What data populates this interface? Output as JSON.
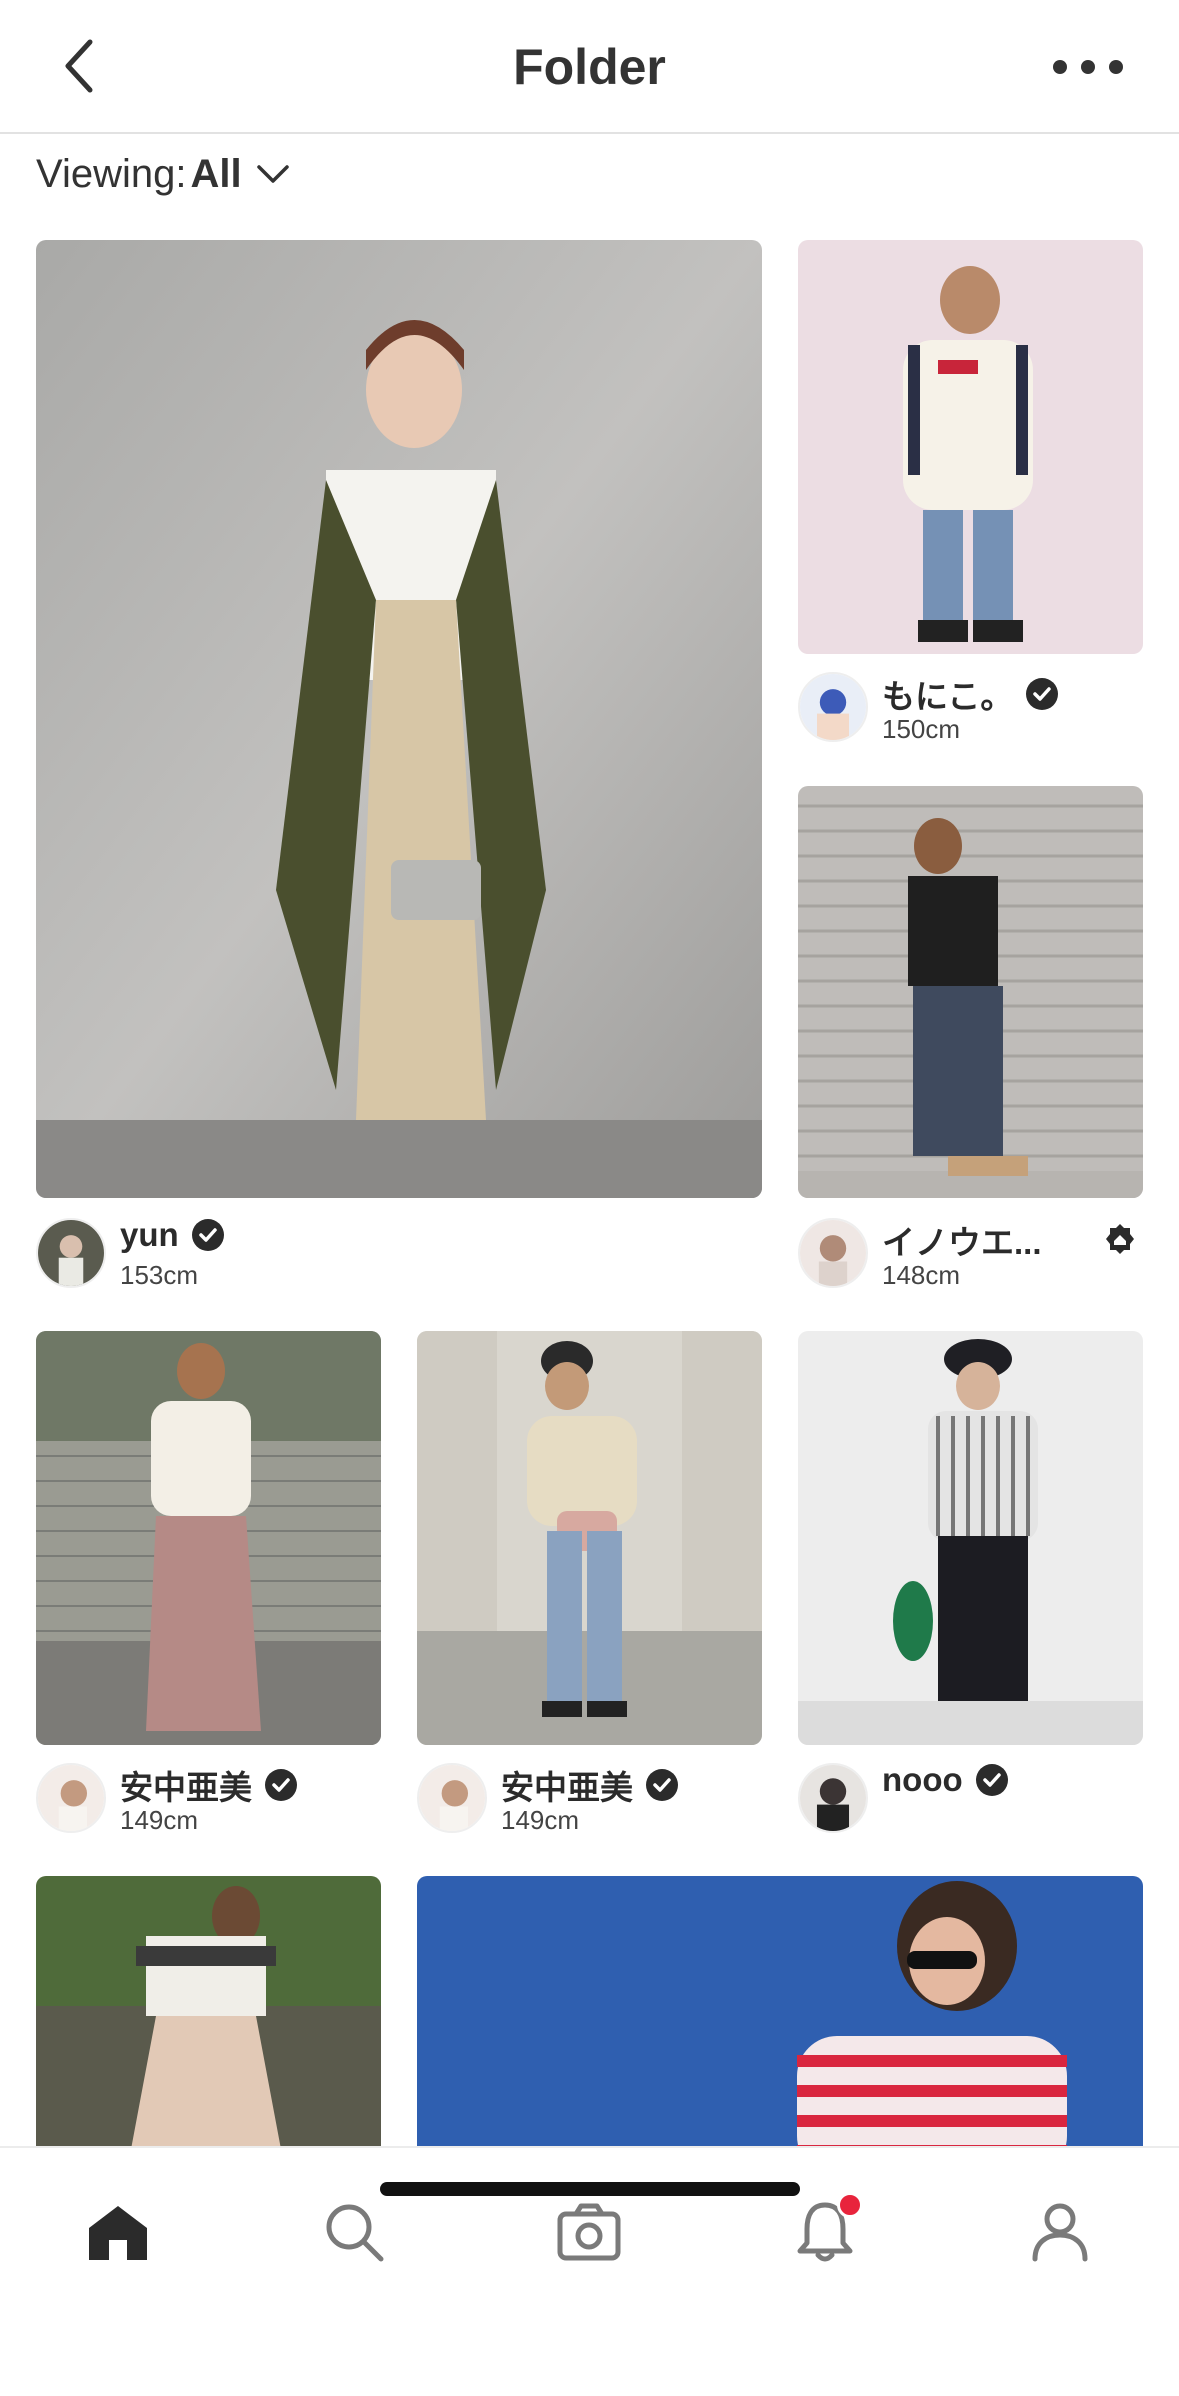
{
  "header": {
    "title": "Folder"
  },
  "filter": {
    "label": "Viewing:",
    "value": "All"
  },
  "posts": [
    {
      "username": "yun",
      "height": "153cm",
      "verified": true
    },
    {
      "username": "もにこ。",
      "height": "150cm",
      "verified": true
    },
    {
      "username": "イノウエ...",
      "height": "148cm",
      "verified": false,
      "shop": true
    },
    {
      "username": "安中亜美",
      "height": "149cm",
      "verified": true
    },
    {
      "username": "安中亜美",
      "height": "149cm",
      "verified": true
    },
    {
      "username": "nooo",
      "height": "",
      "verified": true
    }
  ],
  "tabbar": {
    "items": [
      "home-icon",
      "search-icon",
      "camera-icon",
      "bell-icon",
      "profile-icon"
    ],
    "active": "home-icon",
    "notification_dot": true
  },
  "colors": {
    "accent": "#e8243c",
    "text": "#2b2b2b",
    "divider": "#e2e2e2"
  }
}
